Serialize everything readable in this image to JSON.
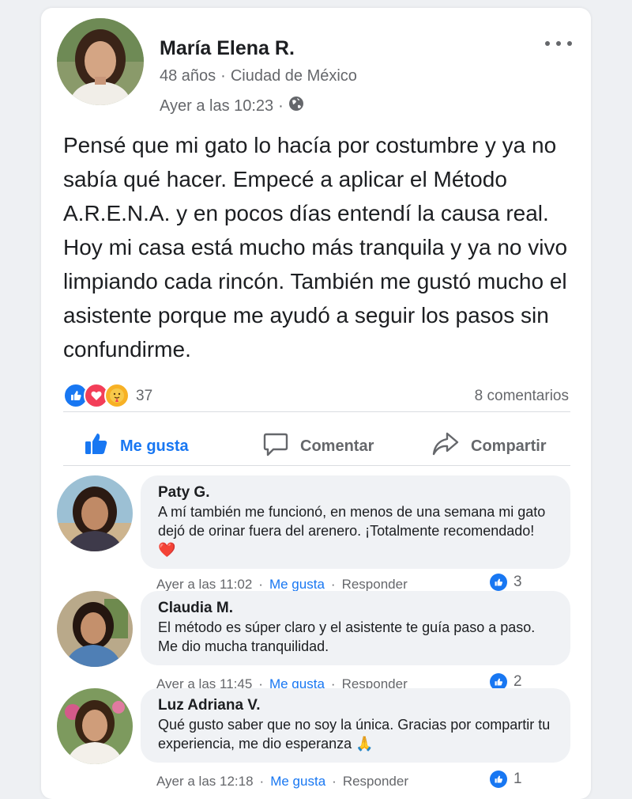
{
  "post": {
    "author": "María Elena R.",
    "age": "48 años",
    "city": "Ciudad de México",
    "time": "Ayer a las 10:23",
    "text": "Pensé que mi gato lo hacía por costumbre y ya no sabía qué hacer. Empecé a aplicar el Método A.R.E.N.A. y en pocos días entendí la causa real. Hoy mi casa está mucho más tranquila y ya no vivo limpiando cada rincón. También me gustó mucho el asistente porque me ayudó a seguir los pasos sin confundirme.",
    "reaction_count": "37",
    "comments_label": "8 comentarios"
  },
  "actions": {
    "like": "Me gusta",
    "comment": "Comentar",
    "share": "Compartir"
  },
  "comments": [
    {
      "name": "Paty G.",
      "text": "A mí también me funcionó, en menos de una semana mi gato dejó de orinar fuera del arenero. ¡Totalmente recomendado! ❤️",
      "time": "Ayer a las 11:02",
      "like_label": "Me gusta",
      "reply_label": "Responder",
      "likes": "3"
    },
    {
      "name": "Claudia M.",
      "text": "El método es súper claro y el asistente te guía paso a paso. Me dio mucha tranquilidad.",
      "time": "Ayer a las 11:45",
      "like_label": "Me gusta",
      "reply_label": "Responder",
      "likes": "2"
    },
    {
      "name": "Luz Adriana V.",
      "text": "Qué gusto saber que no soy la única. Gracias por compartir tu experiencia, me dio esperanza 🙏",
      "time": "Ayer a las 12:18",
      "like_label": "Me gusta",
      "reply_label": "Responder",
      "likes": "1"
    }
  ],
  "colors": {
    "accent": "#1877f2",
    "love": "#f33e58",
    "care": "#f7b125",
    "muted_text": "#65676b",
    "bubble": "#f0f2f5"
  },
  "icons": [
    "more-icon",
    "globe-icon",
    "like-reaction-icon",
    "love-reaction-icon",
    "care-reaction-icon",
    "thumbs-up-icon",
    "comment-icon",
    "share-icon"
  ]
}
